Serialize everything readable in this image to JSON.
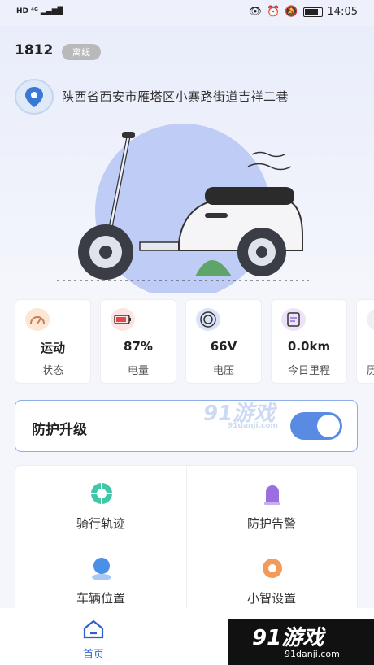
{
  "status_bar": {
    "left": "HD ⁴ᴳ",
    "time": "14:05"
  },
  "device": {
    "id": "1812",
    "status": "离线"
  },
  "location": {
    "address": "陕西省西安市雁塔区小寨路街道吉祥二巷"
  },
  "cards": [
    {
      "value": "运动",
      "label": "状态",
      "icon": "speedometer-icon"
    },
    {
      "value": "87%",
      "label": "电量",
      "icon": "battery-icon"
    },
    {
      "value": "66V",
      "label": "电压",
      "icon": "voltage-icon"
    },
    {
      "value": "0.0km",
      "label": "今日里程",
      "icon": "mileage-icon"
    },
    {
      "value": "",
      "label": "历",
      "icon": "partial-icon"
    }
  ],
  "upgrade": {
    "label": "防护升级",
    "enabled": true
  },
  "watermark_top": {
    "text": "91游戏",
    "url": "91danji.com"
  },
  "grid": [
    {
      "label": "骑行轨迹",
      "icon": "ride-track-icon"
    },
    {
      "label": "防护告警",
      "icon": "alarm-icon"
    },
    {
      "label": "车辆位置",
      "icon": "vehicle-location-icon"
    },
    {
      "label": "小智设置",
      "icon": "settings-icon"
    }
  ],
  "tabbar": {
    "home_label": "首页"
  },
  "watermark_bottom": {
    "text": "91游戏",
    "url": "91danji.com"
  },
  "colors": {
    "accent": "#5a8be3",
    "toggle_on": "#5a8be3",
    "tab_active": "#2d5fc9"
  }
}
